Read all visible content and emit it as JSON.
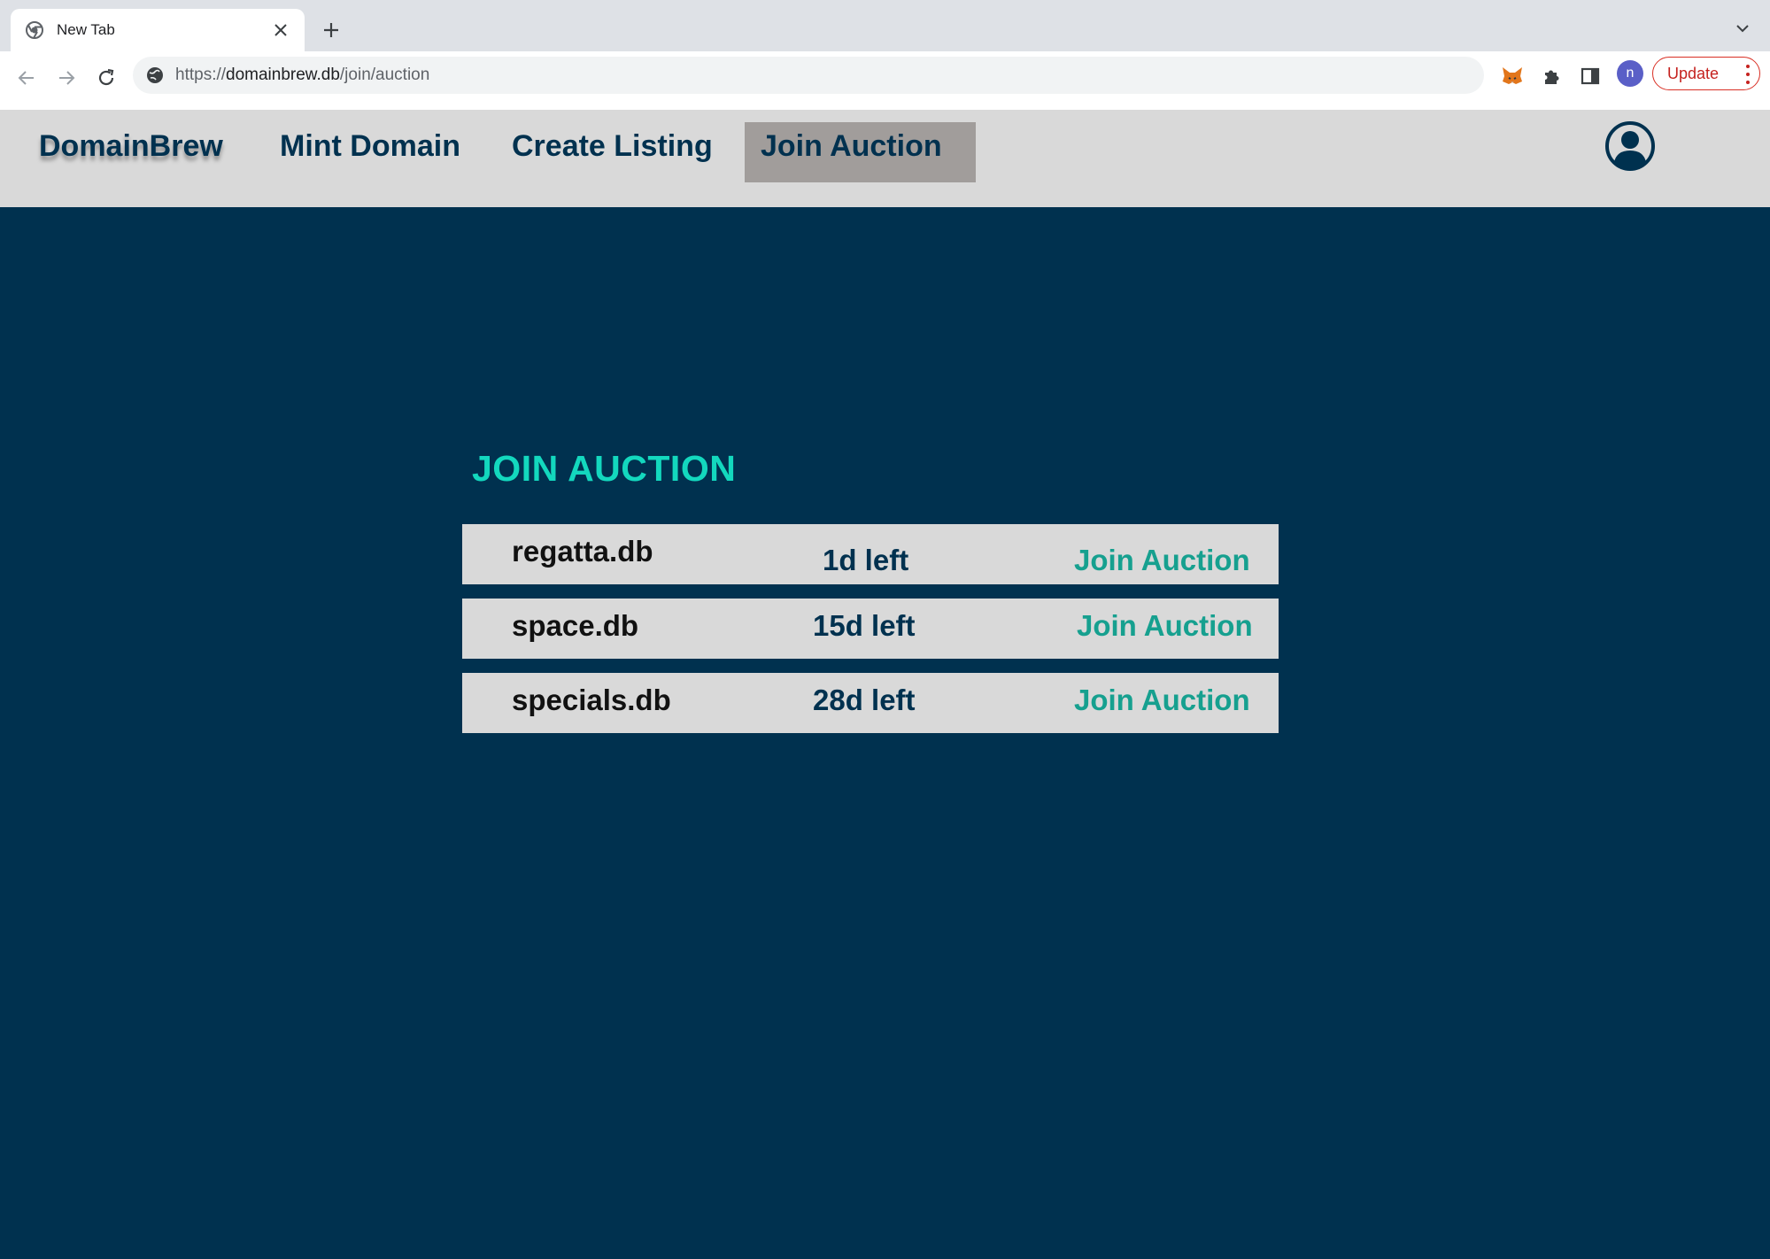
{
  "browser": {
    "tab": {
      "title": "New Tab",
      "favicon": "chrome-icon",
      "close": "close-icon"
    },
    "new_tab": "plus-icon",
    "omnibox": {
      "scheme": "https://",
      "host": "domainbrew.db",
      "path": "/join/auction"
    },
    "profile_initial": "n",
    "update_label": "Update"
  },
  "site": {
    "brand": "DomainBrew",
    "nav": {
      "mint": "Mint Domain",
      "create": "Create Listing",
      "join": "Join Auction"
    },
    "active_nav": "join",
    "account_icon": "user-circle-icon"
  },
  "main": {
    "title": "JOIN AUCTION",
    "auctions": [
      {
        "domain": "regatta.db",
        "time_left": "1d left",
        "action": "Join Auction"
      },
      {
        "domain": "space.db",
        "time_left": "15d left",
        "action": "Join Auction"
      },
      {
        "domain": "specials.db",
        "time_left": "28d left",
        "action": "Join Auction"
      }
    ]
  },
  "colors": {
    "page_bg": "#00314f",
    "nav_bg": "#d9d9d9",
    "nav_active_bg": "#a19d9b",
    "title_accent": "#13d8be",
    "join_link": "#16a08f"
  }
}
